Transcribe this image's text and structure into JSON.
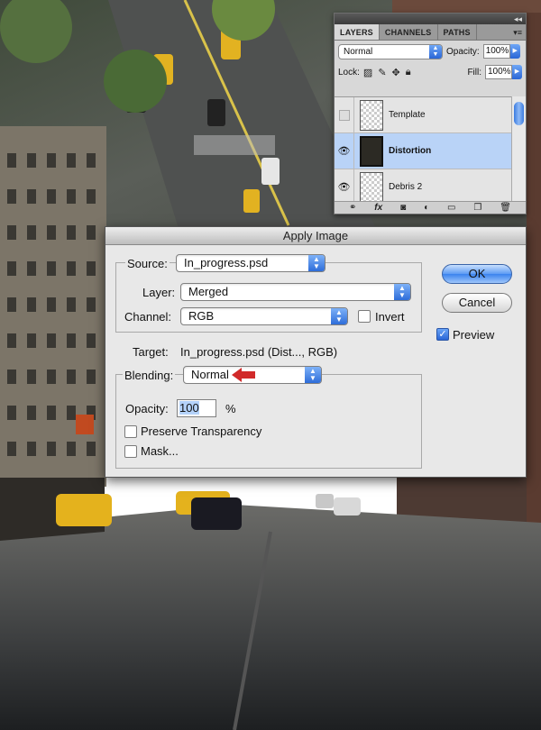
{
  "layers_panel": {
    "tabs": [
      "LAYERS",
      "CHANNELS",
      "PATHS"
    ],
    "active_tab": "LAYERS",
    "blend_mode": "Normal",
    "opacity_label": "Opacity:",
    "opacity_value": "100%",
    "lock_label": "Lock:",
    "fill_label": "Fill:",
    "fill_value": "100%",
    "layers": [
      {
        "name": "Template",
        "visible": false,
        "selected": false
      },
      {
        "name": "Distortion",
        "visible": true,
        "selected": true
      },
      {
        "name": "Debris 2",
        "visible": true,
        "selected": false
      }
    ]
  },
  "dialog": {
    "title": "Apply Image",
    "source_label": "Source:",
    "source_value": "In_progress.psd",
    "layer_label": "Layer:",
    "layer_value": "Merged",
    "channel_label": "Channel:",
    "channel_value": "RGB",
    "invert_label": "Invert",
    "invert_checked": false,
    "target_label": "Target:",
    "target_value": "In_progress.psd (Dist..., RGB)",
    "blending_label": "Blending:",
    "blending_value": "Normal",
    "opacity_label": "Opacity:",
    "opacity_value": "100",
    "opacity_unit": "%",
    "preserve_transparency_label": "Preserve Transparency",
    "preserve_transparency_checked": false,
    "mask_label": "Mask...",
    "mask_checked": false,
    "ok_label": "OK",
    "cancel_label": "Cancel",
    "preview_label": "Preview",
    "preview_checked": true
  },
  "colors": {
    "accent_blue": "#3b83ee",
    "annotation_arrow": "#d12a2a",
    "selected_layer": "#b9d3f7"
  }
}
